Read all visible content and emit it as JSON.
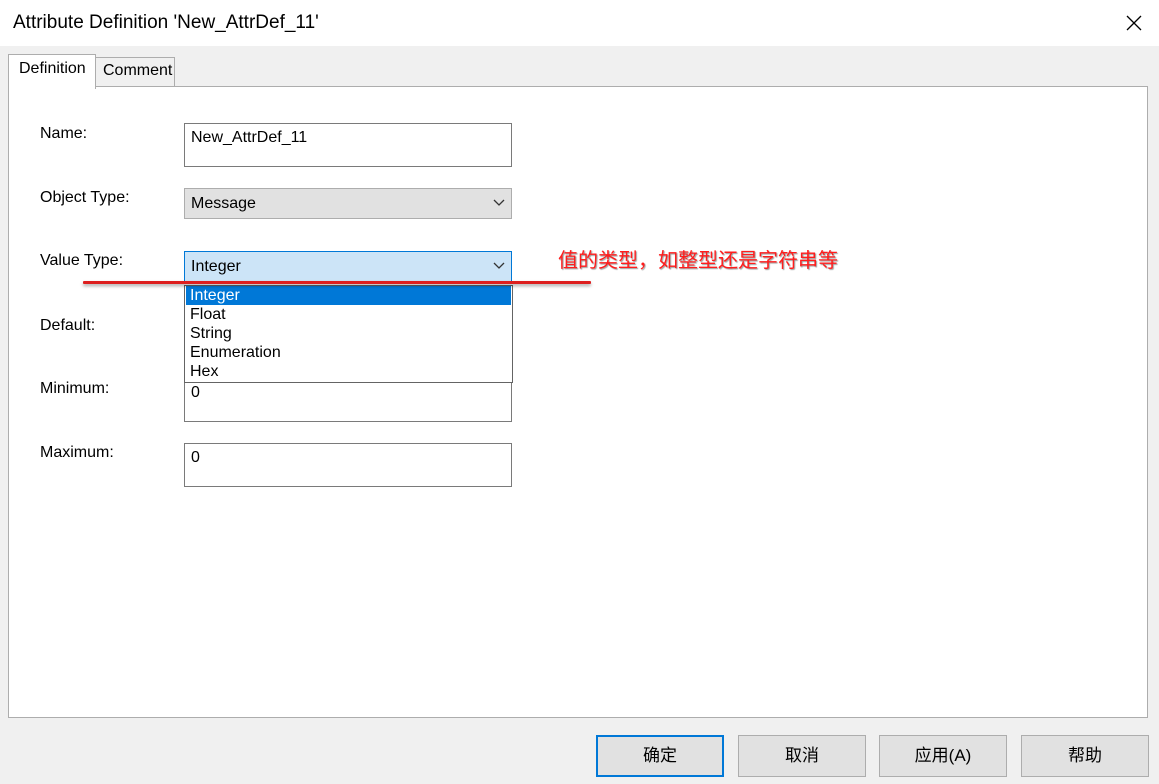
{
  "window": {
    "title": "Attribute Definition 'New_AttrDef_11'",
    "close_icon": "close-icon"
  },
  "tabs": [
    {
      "label": "Definition",
      "active": true
    },
    {
      "label": "Comment",
      "active": false
    }
  ],
  "form": {
    "name_label": "Name:",
    "name_value": "New_AttrDef_11",
    "object_type_label": "Object Type:",
    "object_type_value": "Message",
    "value_type_label": "Value Type:",
    "value_type_value": "Integer",
    "default_label": "Default:",
    "minimum_label": "Minimum:",
    "minimum_value": "0",
    "maximum_label": "Maximum:",
    "maximum_value": "0"
  },
  "dropdown": {
    "options": [
      "Integer",
      "Float",
      "String",
      "Enumeration",
      "Hex"
    ],
    "selected": "Integer"
  },
  "annotation": {
    "text": "值的类型，如整型还是字符串等",
    "color": "#ff1d1d"
  },
  "buttons": {
    "ok": "确定",
    "cancel": "取消",
    "apply": "应用(A)",
    "help": "帮助"
  },
  "colors": {
    "accent": "#0078d7",
    "focus_fill": "#cce4f7",
    "annotation": "#dd1f1f"
  }
}
